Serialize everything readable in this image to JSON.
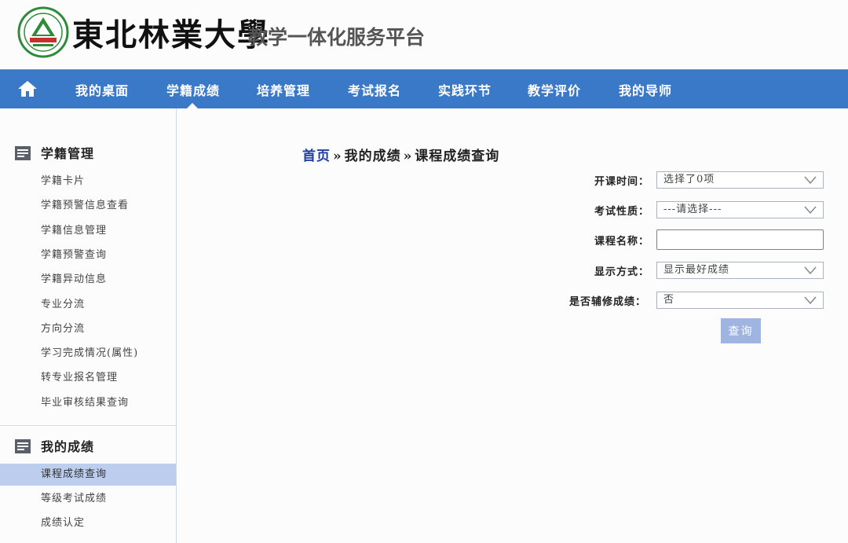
{
  "header": {
    "university_name": "東北林業大學",
    "platform_name": "教学一体化服务平台"
  },
  "nav": {
    "items": [
      "我的桌面",
      "学籍成绩",
      "培养管理",
      "考试报名",
      "实践环节",
      "教学评价",
      "我的导师"
    ],
    "active": "学籍成绩"
  },
  "sidebar": {
    "sections": [
      {
        "title": "学籍管理",
        "items": [
          "学籍卡片",
          "学籍预警信息查看",
          "学籍信息管理",
          "学籍预警查询",
          "学籍异动信息",
          "专业分流",
          "方向分流",
          "学习完成情况(属性)",
          "转专业报名管理",
          "毕业审核结果查询"
        ]
      },
      {
        "title": "我的成绩",
        "items": [
          "课程成绩查询",
          "等级考试成绩",
          "成绩认定"
        ]
      }
    ],
    "active_item": "课程成绩查询"
  },
  "breadcrumb": {
    "home": "首页",
    "separator": "»",
    "level1": "我的成绩",
    "level2": "课程成绩查询"
  },
  "form": {
    "term_label": "开课时间：",
    "term_value": "选择了0项",
    "exam_type_label": "考试性质：",
    "exam_type_value": "---请选择---",
    "course_name_label": "课程名称：",
    "course_name_value": "",
    "display_label": "显示方式：",
    "display_value": "显示最好成绩",
    "minor_label": "是否辅修成绩：",
    "minor_value": "否",
    "query_button": "查询"
  },
  "colors": {
    "nav_bg": "#3a78c8",
    "active_side_bg": "#bccdee",
    "breadcrumb_home": "#1c3ea6",
    "button_bg": "#9fb4e0"
  }
}
